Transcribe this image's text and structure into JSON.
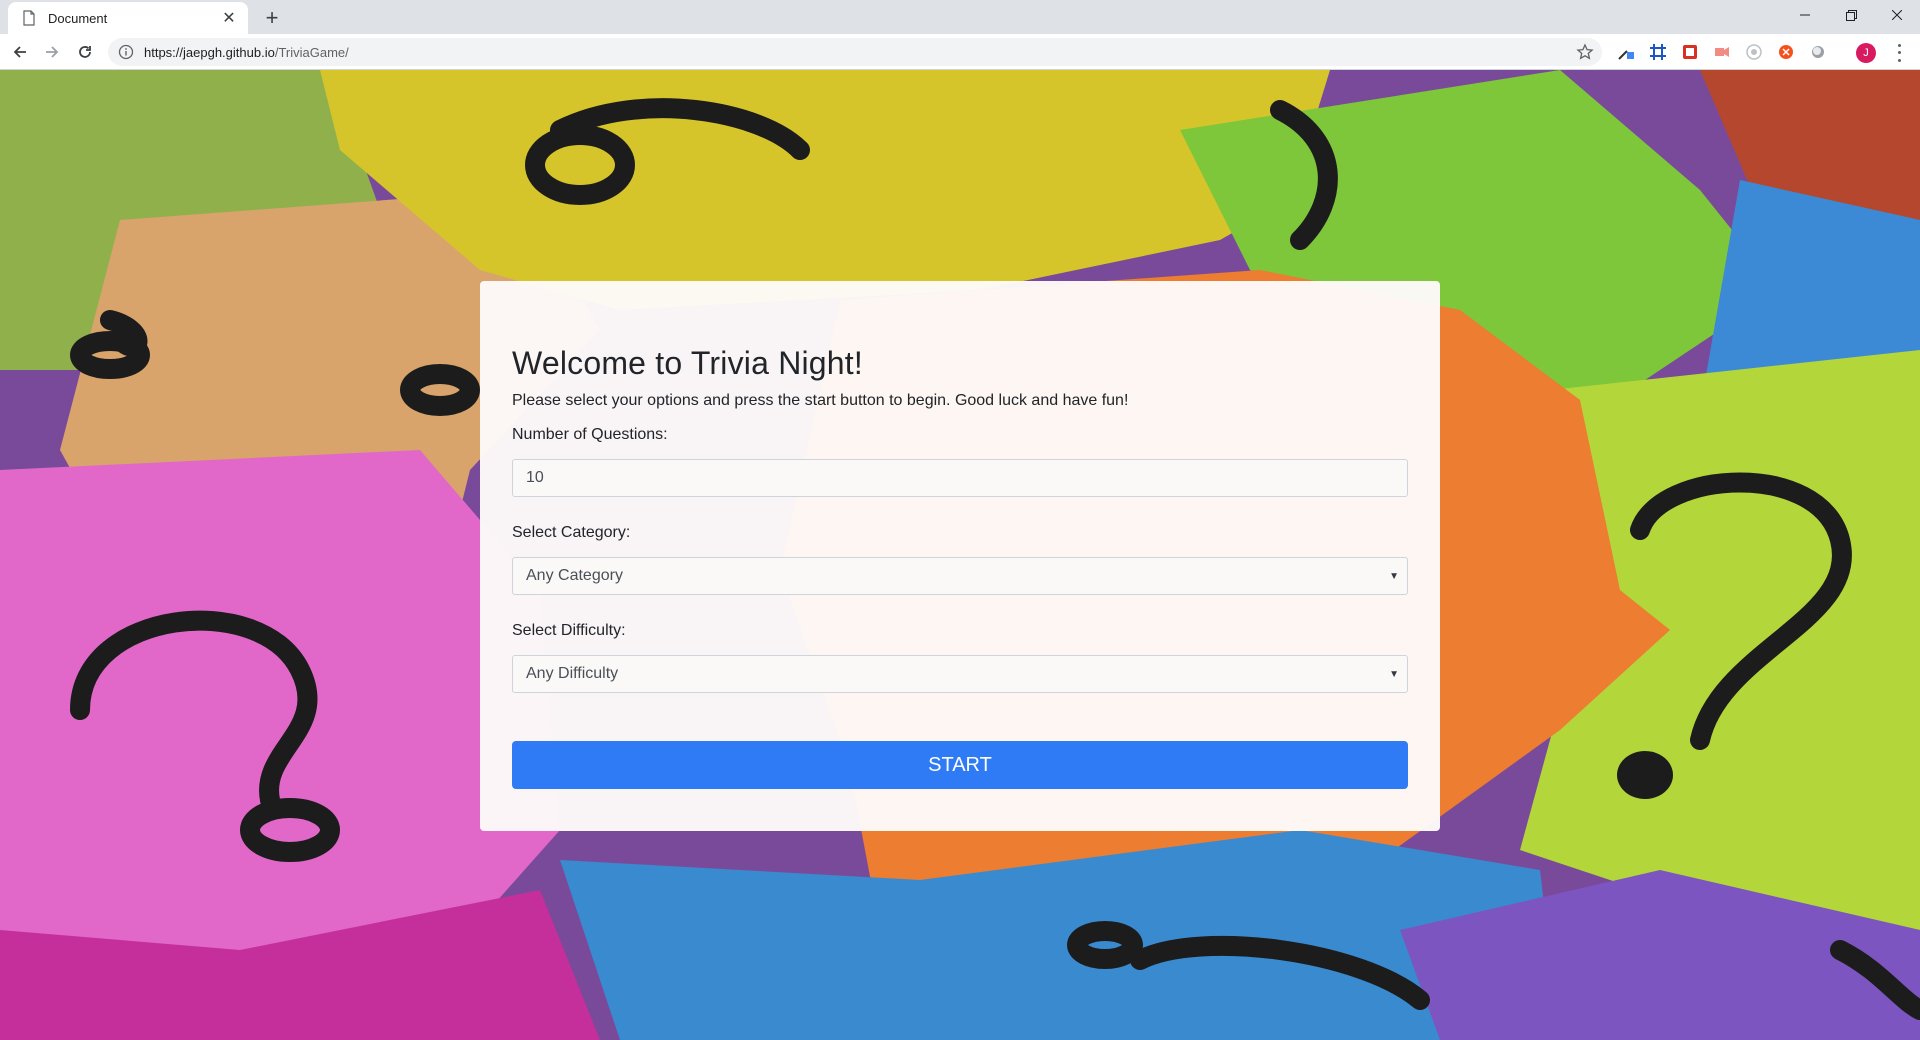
{
  "browser": {
    "tab_title": "Document",
    "new_tab_symbol": "+",
    "url_host": "https://jaepgh.github.io",
    "url_path": "/TriviaGame/",
    "avatar_initial": "J"
  },
  "page": {
    "title": "Welcome to Trivia Night!",
    "intro": "Please select your options and press the start button to begin. Good luck and have fun!",
    "fields": {
      "num_questions_label": "Number of Questions:",
      "num_questions_value": "10",
      "category_label": "Select Category:",
      "category_value": "Any Category",
      "difficulty_label": "Select Difficulty:",
      "difficulty_value": "Any Difficulty"
    },
    "start_label": "START",
    "colors": {
      "start_button": "#2f7bf5",
      "card_background": "#fdfaf9"
    },
    "background": "colorful sticky notes with question marks"
  }
}
